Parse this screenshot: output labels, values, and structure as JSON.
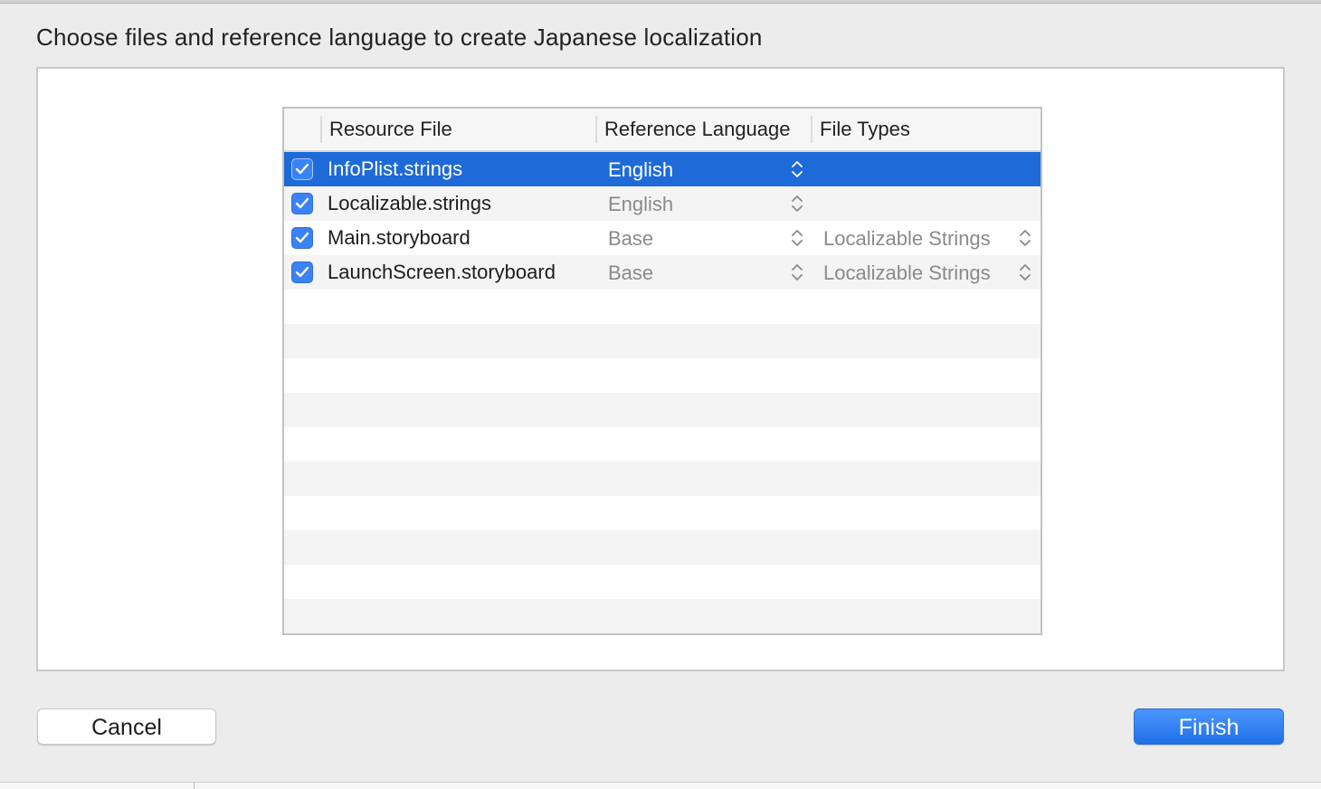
{
  "dialog": {
    "title": "Choose files and reference language to create Japanese localization"
  },
  "table": {
    "columns": {
      "resource_file": "Resource File",
      "reference_language": "Reference Language",
      "file_types": "File Types"
    },
    "rows": [
      {
        "checked": true,
        "file": "InfoPlist.strings",
        "language": "English",
        "file_type": "",
        "selected": true
      },
      {
        "checked": true,
        "file": "Localizable.strings",
        "language": "English",
        "file_type": "",
        "selected": false
      },
      {
        "checked": true,
        "file": "Main.storyboard",
        "language": "Base",
        "file_type": "Localizable Strings",
        "selected": false
      },
      {
        "checked": true,
        "file": "LaunchScreen.storyboard",
        "language": "Base",
        "file_type": "Localizable Strings",
        "selected": false
      }
    ]
  },
  "buttons": {
    "cancel": "Cancel",
    "finish": "Finish"
  },
  "colors": {
    "selection": "#1f6ad9",
    "checkbox": "#3b82f6",
    "accent_button": "#1f6fe6"
  },
  "icons": {
    "checkmark": "checkmark-icon",
    "stepper": "up-down-chevron-icon"
  }
}
